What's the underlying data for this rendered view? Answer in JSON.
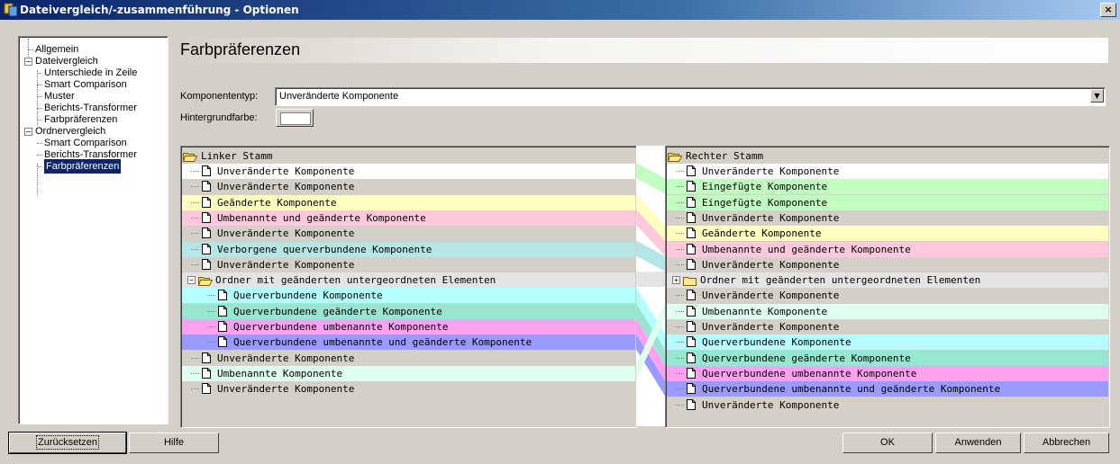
{
  "window": {
    "title": "Dateivergleich/-zusammenführung - Optionen",
    "close_label": "×"
  },
  "nav": [
    {
      "label": "Allgemein",
      "level": 0
    },
    {
      "label": "Dateivergleich",
      "level": 0,
      "expander": "−"
    },
    {
      "label": "Unterschiede in Zeile",
      "level": 1
    },
    {
      "label": "Smart Comparison",
      "level": 1
    },
    {
      "label": "Muster",
      "level": 1
    },
    {
      "label": "Berichts-Transformer",
      "level": 1
    },
    {
      "label": "Farbpräferenzen",
      "level": 1
    },
    {
      "label": "Ordnervergleich",
      "level": 0,
      "expander": "−"
    },
    {
      "label": "Smart Comparison",
      "level": 1
    },
    {
      "label": "Berichts-Transformer",
      "level": 1
    },
    {
      "label": "Farbpräferenzen",
      "level": 1,
      "selected": true
    }
  ],
  "content": {
    "heading": "Farbpräferenzen",
    "component_type_label": "Komponententyp:",
    "component_type_value": "Unveränderte Komponente",
    "background_label": "Hintergrundfarbe:",
    "background_color": "#ffffff"
  },
  "left_tree": {
    "root": "Linker Stamm",
    "rows": [
      {
        "label": "Unveränderte Komponente",
        "color": "#ffffff",
        "indent": 1
      },
      {
        "label": "Unveränderte Komponente",
        "color": "#d4d0c8",
        "indent": 1
      },
      {
        "label": "Geänderte Komponente",
        "color": "#ffffc0",
        "indent": 1
      },
      {
        "label": "Umbenannte und geänderte Komponente",
        "color": "#ffc8dc",
        "indent": 1
      },
      {
        "label": "Unveränderte Komponente",
        "color": "#d4d0c8",
        "indent": 1
      },
      {
        "label": "Verborgene querverbundene Komponente",
        "color": "#b4e6e6",
        "indent": 1
      },
      {
        "label": "Unveränderte Komponente",
        "color": "#d4d0c8",
        "indent": 1
      },
      {
        "label": "Ordner mit geänderten untergeordneten Elementen",
        "color": "#e4e4e4",
        "indent": 1,
        "folder": true,
        "expander": "−"
      },
      {
        "label": "Querverbundene Komponente",
        "color": "#b4ffff",
        "indent": 2
      },
      {
        "label": "Querverbundene geänderte Komponente",
        "color": "#96e6d2",
        "indent": 2
      },
      {
        "label": "Querverbundene umbenannte Komponente",
        "color": "#ffa0f0",
        "indent": 2
      },
      {
        "label": "Querverbundene umbenannte und geänderte Komponente",
        "color": "#9b9bff",
        "indent": 2
      },
      {
        "label": "Unveränderte Komponente",
        "color": "#d4d0c8",
        "indent": 1
      },
      {
        "label": "Umbenannte Komponente",
        "color": "#e0fff0",
        "indent": 1
      },
      {
        "label": "Unveränderte Komponente",
        "color": "#d4d0c8",
        "indent": 1
      }
    ]
  },
  "right_tree": {
    "root": "Rechter Stamm",
    "rows": [
      {
        "label": "Unveränderte Komponente",
        "color": "#ffffff"
      },
      {
        "label": "Eingefügte Komponente",
        "color": "#c0ffc0"
      },
      {
        "label": "Eingefügte Komponente",
        "color": "#c0ffc0"
      },
      {
        "label": "Unveränderte Komponente",
        "color": "#d4d0c8"
      },
      {
        "label": "Geänderte Komponente",
        "color": "#ffffc0"
      },
      {
        "label": "Umbenannte und geänderte Komponente",
        "color": "#ffc8dc"
      },
      {
        "label": "Unveränderte Komponente",
        "color": "#d4d0c8"
      },
      {
        "label": "Ordner mit geänderten untergeordneten Elementen",
        "color": "#e4e4e4",
        "folder": true,
        "expander": "+"
      },
      {
        "label": "Unveränderte Komponente",
        "color": "#d4d0c8"
      },
      {
        "label": "Umbenannte Komponente",
        "color": "#e0fff0"
      },
      {
        "label": "Unveränderte Komponente",
        "color": "#d4d0c8"
      },
      {
        "label": "Querverbundene Komponente",
        "color": "#b4ffff"
      },
      {
        "label": "Querverbundene geänderte Komponente",
        "color": "#96e6d2"
      },
      {
        "label": "Querverbundene umbenannte Komponente",
        "color": "#ffa0f0"
      },
      {
        "label": "Querverbundene umbenannte und geänderte Komponente",
        "color": "#9b9bff"
      },
      {
        "label": "Unveränderte Komponente",
        "color": "#d4d0c8"
      }
    ]
  },
  "buttons": {
    "reset": "Zurücksetzen",
    "help": "Hilfe",
    "ok": "OK",
    "apply": "Anwenden",
    "cancel": "Abbrechen"
  }
}
